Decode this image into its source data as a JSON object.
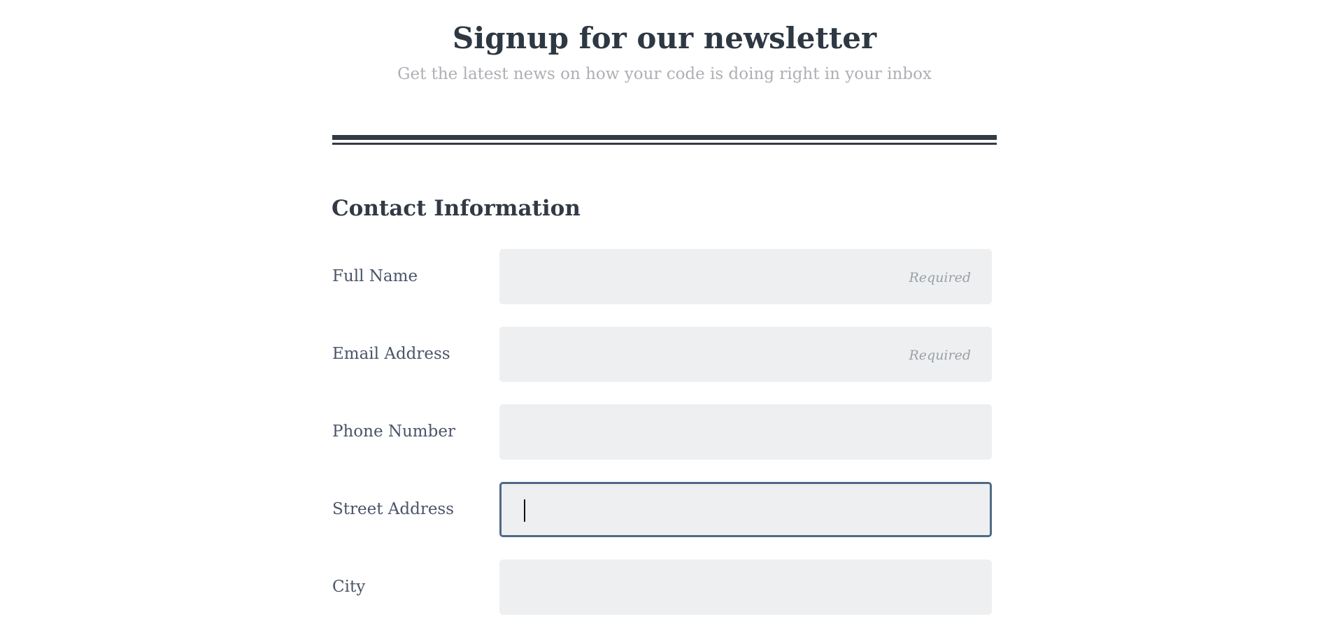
{
  "header": {
    "title": "Signup for our newsletter",
    "subtitle": "Get the latest news on how your code is doing right in your inbox"
  },
  "section": {
    "title": "Contact Information"
  },
  "fields": [
    {
      "label": "Full Name",
      "value": "",
      "placeholder": "Required"
    },
    {
      "label": "Email Address",
      "value": "",
      "placeholder": "Required"
    },
    {
      "label": "Phone Number",
      "value": "",
      "placeholder": ""
    },
    {
      "label": "Street Address",
      "value": "",
      "placeholder": "",
      "focused": true
    },
    {
      "label": "City",
      "value": "",
      "placeholder": ""
    }
  ],
  "colors": {
    "text": "#323a45",
    "subtitle": "#aeb0b5",
    "input_bg": "#eeeff0",
    "focus_border": "#4f6a85"
  }
}
